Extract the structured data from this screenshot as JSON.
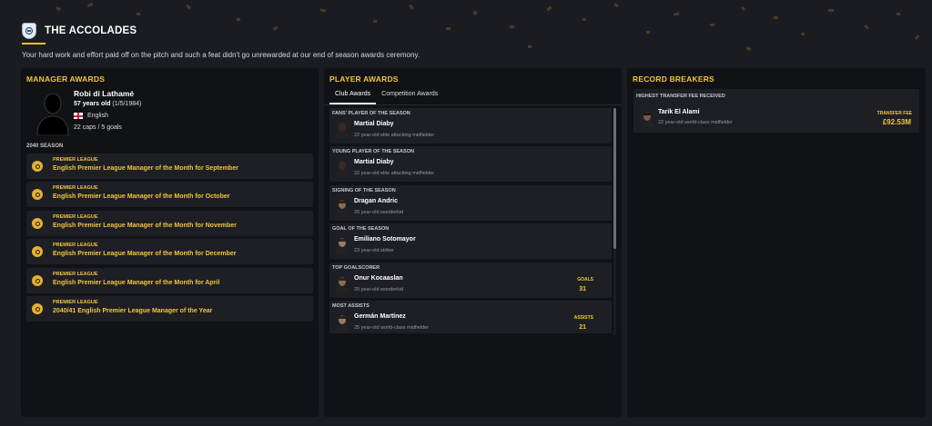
{
  "header": {
    "title": "THE ACCOLADES",
    "subtitle": "Your hard work and effort paid off on the pitch and such a feat didn't go unrewarded at our end of season awards ceremony."
  },
  "colors": {
    "accent": "#f2c53d",
    "panel": "#111216",
    "card": "#1e1f25",
    "background": "#1b1c21"
  },
  "manager_awards": {
    "title": "MANAGER AWARDS",
    "name": "Robi di Lathamé",
    "age": "57 years old",
    "dob": "(1/5/1984)",
    "nationality": "English",
    "caps": "22 caps / 5 goals",
    "season": "2040 SEASON",
    "awards": [
      {
        "competition": "PREMIER LEAGUE",
        "name": "English Premier League Manager of the Month for September"
      },
      {
        "competition": "PREMIER LEAGUE",
        "name": "English Premier League Manager of the Month for October"
      },
      {
        "competition": "PREMIER LEAGUE",
        "name": "English Premier League Manager of the Month for November"
      },
      {
        "competition": "PREMIER LEAGUE",
        "name": "English Premier League Manager of the Month for December"
      },
      {
        "competition": "PREMIER LEAGUE",
        "name": "English Premier League Manager of the Month for April"
      },
      {
        "competition": "PREMIER LEAGUE",
        "name": "2040/41 English Premier League Manager of the Year"
      }
    ]
  },
  "player_awards": {
    "title": "PLAYER AWARDS",
    "tabs": [
      "Club Awards",
      "Competition Awards"
    ],
    "active_tab": 0,
    "items": [
      {
        "label": "FANS' PLAYER OF THE SEASON",
        "name": "Martial Diaby",
        "desc": "22 year-old elite attacking midfielder",
        "stat_label": "",
        "stat_value": ""
      },
      {
        "label": "YOUNG PLAYER OF THE SEASON",
        "name": "Martial Diaby",
        "desc": "22 year-old elite attacking midfielder",
        "stat_label": "",
        "stat_value": ""
      },
      {
        "label": "SIGNING OF THE SEASON",
        "name": "Dragan Andric",
        "desc": "20 year-old wonderkid",
        "stat_label": "",
        "stat_value": ""
      },
      {
        "label": "GOAL OF THE SEASON",
        "name": "Emiliano Sotomayor",
        "desc": "23 year-old striker",
        "stat_label": "",
        "stat_value": ""
      },
      {
        "label": "TOP GOALSCORER",
        "name": "Onur Kocaaslan",
        "desc": "20 year-old wonderkid",
        "stat_label": "GOALS",
        "stat_value": "31"
      },
      {
        "label": "MOST ASSISTS",
        "name": "Germán Martínez",
        "desc": "25 year-old world-class midfielder",
        "stat_label": "ASSISTS",
        "stat_value": "21"
      }
    ]
  },
  "record_breakers": {
    "title": "RECORD BREAKERS",
    "label": "HIGHEST TRANSFER FEE RECEIVED",
    "name": "Tarik El Alami",
    "desc": "22 year-old world-class midfielder",
    "stat_label": "TRANSFER FEE",
    "stat_value": "£92.53M"
  }
}
